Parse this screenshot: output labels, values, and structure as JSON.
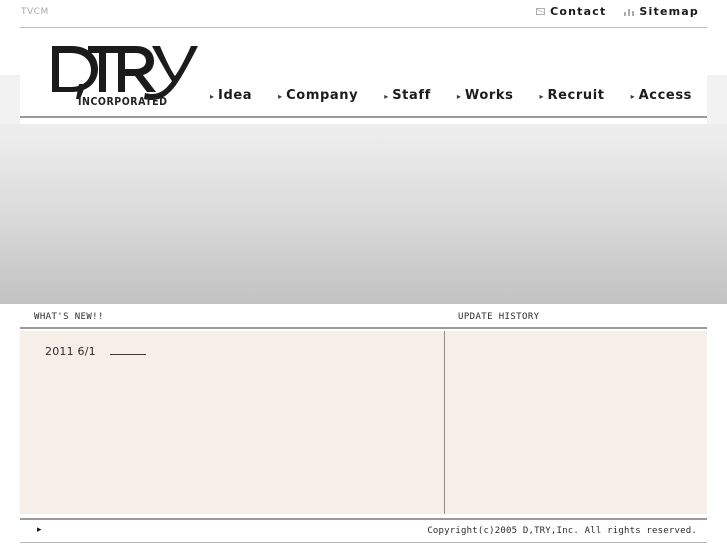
{
  "utility": {
    "left_label": "TVCM",
    "links": [
      {
        "label": "Contact",
        "icon": "mail-icon"
      },
      {
        "label": "Sitemap",
        "icon": "sitemap-icon"
      }
    ]
  },
  "brand": {
    "wordmark": "D,TRY",
    "subtitle": "INCORPORATED"
  },
  "nav": {
    "items": [
      {
        "label": "Idea",
        "marker": "▸"
      },
      {
        "label": "Company",
        "marker": "▸"
      },
      {
        "label": "Staff",
        "marker": "▸"
      },
      {
        "label": "Works",
        "marker": "▸"
      },
      {
        "label": "Recruit",
        "marker": "▸"
      },
      {
        "label": "Access",
        "marker": "▸"
      }
    ]
  },
  "panels": {
    "whats_new": {
      "header": "WHAT'S NEW!!",
      "entries": [
        {
          "date": "2011 6/1",
          "title": ""
        }
      ]
    },
    "update_history": {
      "header": "UPDATE HISTORY",
      "entries": []
    }
  },
  "footer": {
    "page_top_marker": "▸",
    "copyright": "Copyright(c)2005 D,TRY,Inc. All rights reserved."
  },
  "colors": {
    "panel_background": "#F5EFE7",
    "hero_gradient_top": "#EDEDED",
    "hero_gradient_bottom": "#C3C3C3",
    "rule": "#9A9A9A",
    "text": "#1C1C1C",
    "muted_text": "#A8A8A8"
  }
}
